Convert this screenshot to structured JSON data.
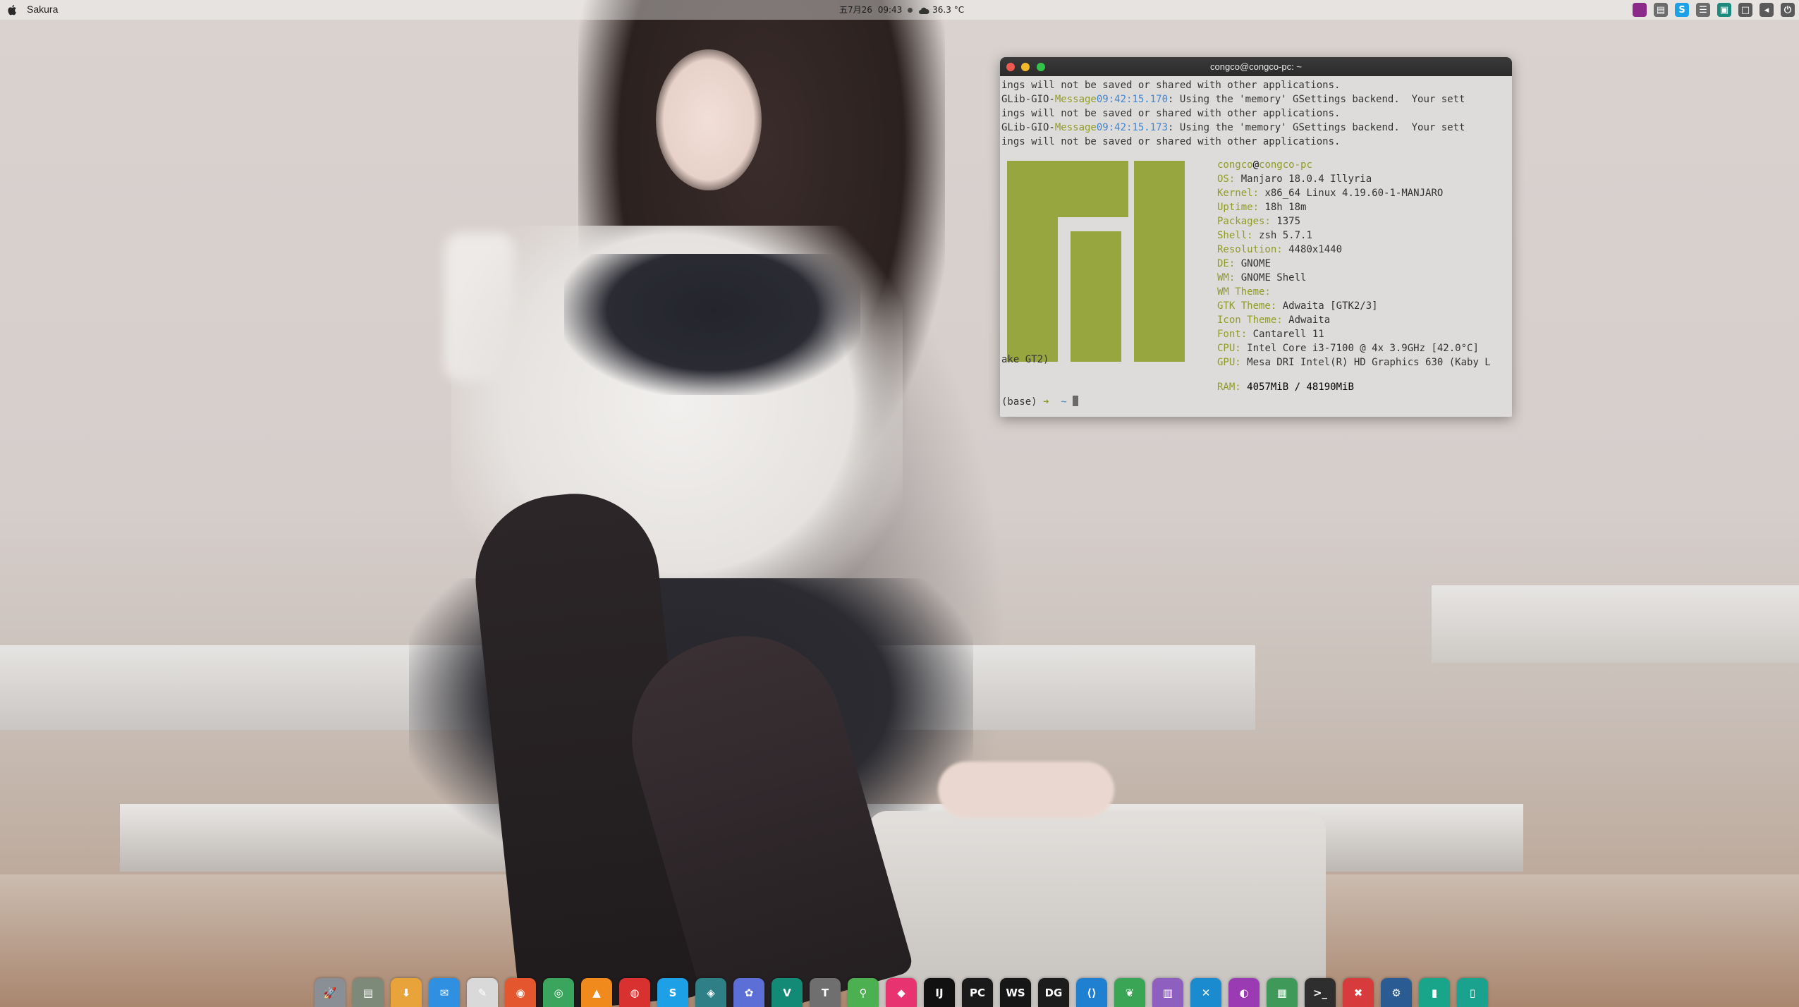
{
  "topbar": {
    "app_name": "Sakura",
    "date": "五7月26",
    "time": "09:43",
    "temperature": "36.3 °C",
    "tray_icons": [
      {
        "name": "firefox-dev-icon",
        "color": "#8c2a8a",
        "glyph": ""
      },
      {
        "name": "printer-icon",
        "color": "#6c6c6c",
        "glyph": "▤"
      },
      {
        "name": "skype-icon",
        "color": "#1ea0e6",
        "glyph": "S"
      },
      {
        "name": "keyboard-icon",
        "color": "#6c6c6c",
        "glyph": "☰"
      },
      {
        "name": "image-viewer-icon",
        "color": "#1d8a7e",
        "glyph": "▣"
      },
      {
        "name": "display-icon",
        "color": "#5a5a5a",
        "glyph": "□"
      },
      {
        "name": "volume-icon",
        "color": "#5a5a5a",
        "glyph": "◂"
      },
      {
        "name": "power-icon",
        "color": "#5a5a5a",
        "glyph": "⏻"
      }
    ]
  },
  "terminal": {
    "title": "congco@congco-pc: ~",
    "log_lines": [
      {
        "prefix": "",
        "tag": "",
        "time": "",
        "text": "ings will not be saved or shared with other applications."
      },
      {
        "prefix": "GLib-GIO-",
        "tag": "Message",
        "time": "09:42:15.170",
        "text": ": Using the 'memory' GSettings backend.  Your sett"
      },
      {
        "prefix": "",
        "tag": "",
        "time": "",
        "text": "ings will not be saved or shared with other applications."
      },
      {
        "prefix": "GLib-GIO-",
        "tag": "Message",
        "time": "09:42:15.173",
        "text": ": Using the 'memory' GSettings backend.  Your sett"
      },
      {
        "prefix": "",
        "tag": "",
        "time": "",
        "text": "ings will not be saved or shared with other applications."
      }
    ],
    "user": "congco",
    "host": "congco-pc",
    "sysinfo": [
      {
        "key": "OS:",
        "value": "Manjaro 18.0.4 Illyria"
      },
      {
        "key": "Kernel:",
        "value": "x86_64 Linux 4.19.60-1-MANJARO"
      },
      {
        "key": "Uptime:",
        "value": "18h 18m"
      },
      {
        "key": "Packages:",
        "value": "1375"
      },
      {
        "key": "Shell:",
        "value": "zsh 5.7.1"
      },
      {
        "key": "Resolution:",
        "value": "4480x1440"
      },
      {
        "key": "DE:",
        "value": "GNOME"
      },
      {
        "key": "WM:",
        "value": "GNOME Shell"
      },
      {
        "key": "WM Theme:",
        "value": ""
      },
      {
        "key": "GTK Theme:",
        "value": "Adwaita [GTK2/3]"
      },
      {
        "key": "Icon Theme:",
        "value": "Adwaita"
      },
      {
        "key": "Font:",
        "value": "Cantarell 11"
      },
      {
        "key": "CPU:",
        "value": "Intel Core i3-7100 @ 4x 3.9GHz [42.0°C]"
      },
      {
        "key": "GPU:",
        "value": "Mesa DRI Intel(R) HD Graphics 630 (Kaby L"
      }
    ],
    "gpu_overflow": "ake GT2)",
    "ram_key": "RAM:",
    "ram_value": "4057MiB / 48190MiB",
    "prompt_env": "(base)",
    "prompt_arrow": "➜",
    "prompt_dir": "~",
    "logo_color": "#97a63f"
  },
  "dock": [
    {
      "name": "launchpad-icon",
      "glyph": "🚀",
      "color": "#8a8f96"
    },
    {
      "name": "files-icon",
      "glyph": "▤",
      "color": "#7d8a7a"
    },
    {
      "name": "downloader-icon",
      "glyph": "⬇",
      "color": "#e8a33a"
    },
    {
      "name": "mail-icon",
      "glyph": "✉",
      "color": "#2f8fe0"
    },
    {
      "name": "document-viewer-icon",
      "glyph": "✎",
      "color": "#d9d9d9"
    },
    {
      "name": "firefox-icon",
      "glyph": "◉",
      "color": "#e4572e"
    },
    {
      "name": "chrome-icon",
      "glyph": "◎",
      "color": "#3ba55d"
    },
    {
      "name": "vlc-icon",
      "glyph": "▲",
      "color": "#f08a1c"
    },
    {
      "name": "netease-music-icon",
      "glyph": "◍",
      "color": "#d8312f"
    },
    {
      "name": "skype-icon",
      "glyph": "S",
      "color": "#1ea0e6"
    },
    {
      "name": "browser-icon",
      "glyph": "◈",
      "color": "#2f7f86"
    },
    {
      "name": "gitkraken-icon",
      "glyph": "✿",
      "color": "#5b6fd6"
    },
    {
      "name": "vim-icon",
      "glyph": "V",
      "color": "#138a76"
    },
    {
      "name": "typora-icon",
      "glyph": "T",
      "color": "#6f6f6f"
    },
    {
      "name": "maps-icon",
      "glyph": "⚲",
      "color": "#4caf50"
    },
    {
      "name": "jetbrains-toolbox-icon",
      "glyph": "◆",
      "color": "#e7336f"
    },
    {
      "name": "intellij-idea-icon",
      "glyph": "IJ",
      "color": "#111111"
    },
    {
      "name": "pycharm-icon",
      "glyph": "PC",
      "color": "#1a1a1a"
    },
    {
      "name": "webstorm-icon",
      "glyph": "WS",
      "color": "#161616"
    },
    {
      "name": "datagrip-icon",
      "glyph": "DG",
      "color": "#1c1c1c"
    },
    {
      "name": "vscode-icon",
      "glyph": "⟨⟩",
      "color": "#1f7fd0"
    },
    {
      "name": "mongodb-compass-icon",
      "glyph": "❦",
      "color": "#3aa655"
    },
    {
      "name": "purple-app-icon",
      "glyph": "▥",
      "color": "#8f5fc0"
    },
    {
      "name": "shutter-icon",
      "glyph": "✕",
      "color": "#1b8bd0"
    },
    {
      "name": "phpstorm-icon",
      "glyph": "◐",
      "color": "#9b3bb3"
    },
    {
      "name": "system-monitor-icon",
      "glyph": "▦",
      "color": "#3f9a5a"
    },
    {
      "name": "terminal-icon",
      "glyph": ">_",
      "color": "#2e2e2e"
    },
    {
      "name": "xmind-icon",
      "glyph": "✖",
      "color": "#d83b3b"
    },
    {
      "name": "steam-icon",
      "glyph": "⚙",
      "color": "#2a5c93"
    },
    {
      "name": "reader-icon",
      "glyph": "▮",
      "color": "#19a589"
    },
    {
      "name": "notes-icon",
      "glyph": "▯",
      "color": "#1ba28e"
    }
  ]
}
